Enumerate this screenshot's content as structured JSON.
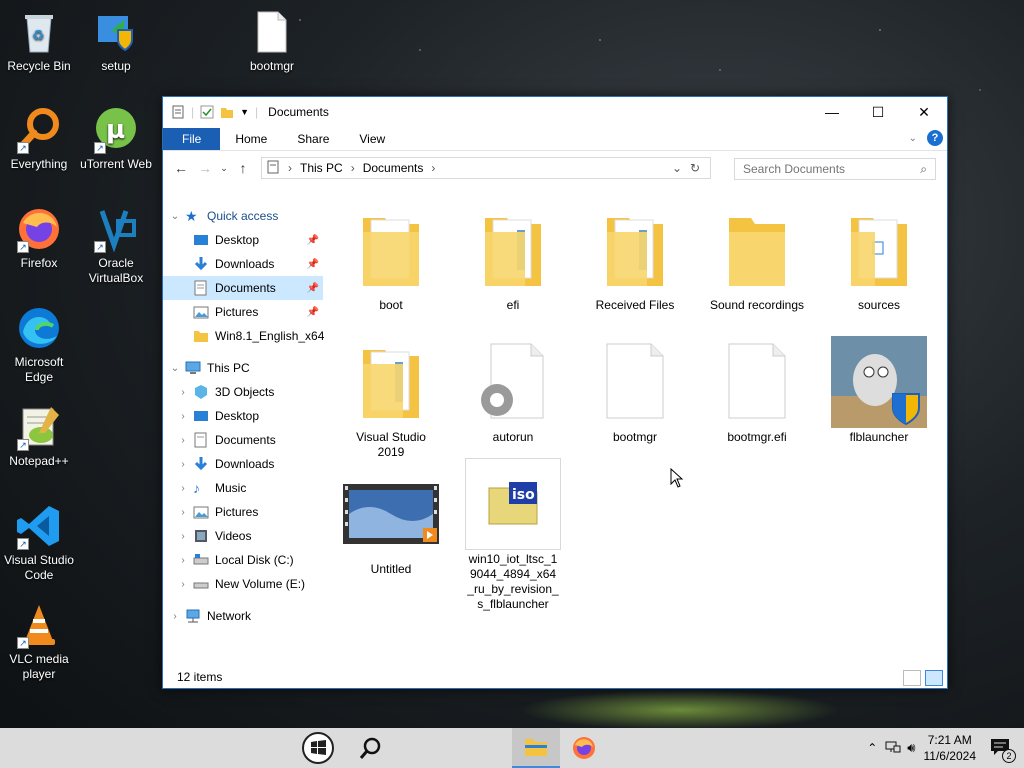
{
  "desktop": {
    "icons": [
      {
        "label": "Recycle Bin"
      },
      {
        "label": "setup"
      },
      {
        "label": "bootmgr"
      },
      {
        "label": "Everything"
      },
      {
        "label": "uTorrent Web"
      },
      {
        "label": "Firefox"
      },
      {
        "label": "Oracle VirtualBox"
      },
      {
        "label": "Microsoft Edge"
      },
      {
        "label": "Notepad++"
      },
      {
        "label": "Visual Studio Code"
      },
      {
        "label": "VLC media player"
      }
    ]
  },
  "window": {
    "title": "Documents",
    "ribbon_tabs": [
      "File",
      "Home",
      "Share",
      "View"
    ],
    "breadcrumb": [
      "This PC",
      "Documents"
    ],
    "search_placeholder": "Search Documents",
    "status": "12 items"
  },
  "nav": {
    "quick_access": "Quick access",
    "quick_items": [
      "Desktop",
      "Downloads",
      "Documents",
      "Pictures",
      "Win8.1_English_x64"
    ],
    "this_pc": "This PC",
    "pc_items": [
      "3D Objects",
      "Desktop",
      "Documents",
      "Downloads",
      "Music",
      "Pictures",
      "Videos",
      "Local Disk (C:)",
      "New Volume (E:)"
    ],
    "network": "Network"
  },
  "files": [
    {
      "name": "boot"
    },
    {
      "name": "efi"
    },
    {
      "name": "Received Files"
    },
    {
      "name": "Sound recordings"
    },
    {
      "name": "sources"
    },
    {
      "name": "Visual Studio 2019"
    },
    {
      "name": "autorun"
    },
    {
      "name": "bootmgr"
    },
    {
      "name": "bootmgr.efi"
    },
    {
      "name": "flblauncher"
    },
    {
      "name": "Untitled"
    },
    {
      "name": "win10_iot_ltsc_19044_4894_x64_ru_by_revision_s_flblauncher"
    }
  ],
  "taskbar": {
    "time": "7:21 AM",
    "date": "11/6/2024",
    "notification_count": "2"
  },
  "colors": {
    "accent": "#1a5fb4",
    "selection": "#cce8ff",
    "folder": "#f5c342"
  }
}
